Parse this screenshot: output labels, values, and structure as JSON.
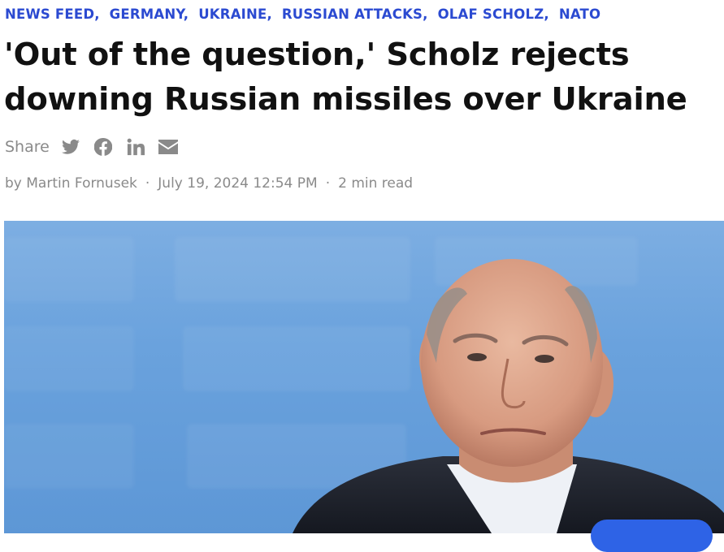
{
  "tags": [
    "NEWS FEED",
    "GERMANY",
    "UKRAINE",
    "RUSSIAN ATTACKS",
    "OLAF SCHOLZ",
    "NATO"
  ],
  "headline": "'Out of the question,' Scholz rejects downing Russian missiles over Ukraine",
  "share": {
    "label": "Share",
    "icons": [
      "twitter-icon",
      "facebook-icon",
      "linkedin-icon",
      "email-icon"
    ]
  },
  "byline": {
    "author": "by Martin Fornusek",
    "date": "July 19, 2024 12:54 PM",
    "read_time": "2 min read"
  },
  "colors": {
    "tag_blue": "#2b4ad1",
    "muted_gray": "#8a8a8a",
    "photo_bg": "#6aa2dd",
    "button_blue": "#2e63e6"
  }
}
